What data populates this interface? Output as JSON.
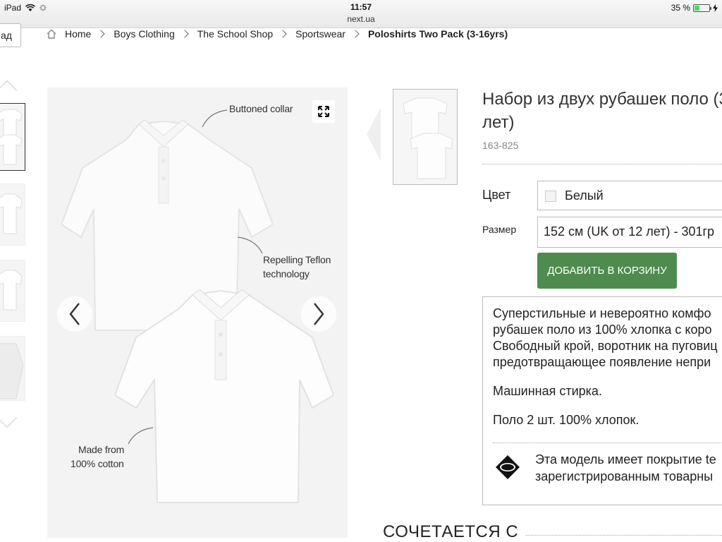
{
  "status_bar": {
    "device": "iPad",
    "time": "11:57",
    "url": "next.ua",
    "battery": "35 %",
    "battery_level": 0.35
  },
  "back_button": {
    "label": "ад"
  },
  "breadcrumb": {
    "items": [
      "Home",
      "Boys Clothing",
      "The School Shop",
      "Sportswear"
    ],
    "current": "Poloshirts Two Pack (3-16yrs)"
  },
  "image_labels": {
    "collar": "Buttoned collar",
    "teflon_line1": "Repelling Teflon",
    "teflon_line2": "technology",
    "cotton_line1": "Made from",
    "cotton_line2": "100% cotton"
  },
  "product": {
    "title_line1": "Набор из двух рубашек поло (3",
    "title_line2": "лет)",
    "sku": "163-825",
    "color_label": "Цвет",
    "color_value": "Белый",
    "size_label": "Размер",
    "size_value": "152 см (UK от 12 лет) - 301гр",
    "add_to_cart": "ДОБАВИТЬ В КОРЗИНУ"
  },
  "description": {
    "lines": [
      "Суперстильные и невероятно комфо",
      "рубашек поло из 100% хлопка с коро",
      "Свободный крой, воротник на пуговиц",
      "предотвращающее появление непри"
    ],
    "washing": "Машинная стирка.",
    "composition": "Поло 2 шт. 100% хлопок.",
    "teflon_line1": "Эта модель имеет покрытие te",
    "teflon_line2": "зарегистрированным товарны"
  },
  "matches_heading": "СОЧЕТАЕТСЯ С"
}
